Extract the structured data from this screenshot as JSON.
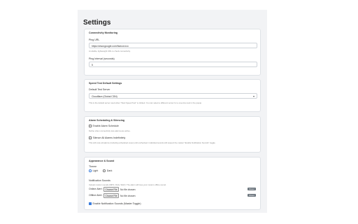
{
  "page": {
    "title": "Settings"
  },
  "connectivity": {
    "heading": "Connectivity Monitoring",
    "ping_url_label": "Ping URL",
    "ping_url_value": "https://www.google.com/favicon.ico",
    "ping_url_help": "A reliable, lightweight URL to check connectivity.",
    "ping_interval_label": "Ping Interval (seconds)",
    "ping_interval_value": "5"
  },
  "speedtest": {
    "heading": "Speed Test Default Settings",
    "server_label": "Default Test Server",
    "server_value": "Cloudflare (Global CDN)",
    "server_help": "This is the default server used when \"Start Speed Test\" is clicked. You can select a different server for a one-time test in the popup."
  },
  "alarm": {
    "heading": "Alarm Scheduling & Silencing",
    "enable_schedule_label": "Enable Alarm Schedule",
    "enable_schedule_help": "Define when connectivity loss alarms are active.",
    "silence_label": "Silence All Alarms Indefinitely",
    "silence_help": "This will mute all alarms (including scheduled ones) until unchecked. Individual sounds still respect the master \"Enable Notification Sounds\" toggle."
  },
  "appearance": {
    "heading": "Appearance & Sound",
    "theme_label": "Theme",
    "theme_light": "Light",
    "theme_dark": "Dark",
    "sounds_label": "Notification Sounds",
    "sounds_help": "Upload custom sounds (MP3, OGG, WAV). The alarm will loop your custom offline sound.",
    "online_label": "Online Alert:",
    "offline_label": "Offline Alert:",
    "choose_file": "Choose File",
    "no_file": "No file chosen",
    "reset_label": "Reset",
    "enable_sounds_label": "Enable Notification Sounds (Master Toggle)"
  },
  "colors": {
    "accent": "#3b7ddd",
    "reset_button": "#6c757d"
  }
}
